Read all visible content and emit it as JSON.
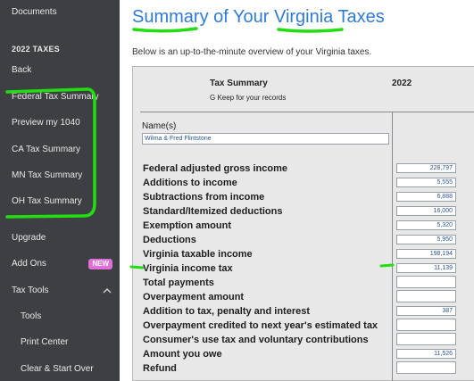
{
  "sidebar": {
    "documents": "Documents",
    "section": "2022 TAXES",
    "back": "Back",
    "items": [
      {
        "label": "Federal Tax Summary"
      },
      {
        "label": "Preview my 1040"
      },
      {
        "label": "CA Tax Summary"
      },
      {
        "label": "MN Tax Summary"
      },
      {
        "label": "OH Tax Summary"
      }
    ],
    "upgrade": "Upgrade",
    "add_ons": "Add Ons",
    "new_badge": "NEW",
    "tax_tools": "Tax Tools",
    "tools": "Tools",
    "print_center": "Print Center",
    "clear_start_over": "Clear & Start Over",
    "colors": {
      "background": "#3d3f43",
      "badge": "#e070d8"
    }
  },
  "main": {
    "title": "Summary of Your Virginia Taxes",
    "subtitle": "Below is an up-to-the-minute overview of your Virginia taxes.",
    "form": {
      "header": "Tax Summary",
      "year": "2022",
      "keep": "G Keep for your records",
      "names_label": "Name(s)",
      "names_value": "Wilma & Fred Flintstone",
      "rows": [
        {
          "label": "Federal adjusted gross income",
          "value": "228,797"
        },
        {
          "label": "Additions to income",
          "value": "5,555"
        },
        {
          "label": "Subtractions from income",
          "value": "6,888"
        },
        {
          "label": "Standard/Itemized deductions",
          "value": "16,000"
        },
        {
          "label": "Exemption amount",
          "value": "5,320"
        },
        {
          "label": "Deductions",
          "value": "5,950"
        },
        {
          "label": "Virginia taxable income",
          "value": "198,194"
        },
        {
          "label": "Virginia income tax",
          "value": "11,139"
        },
        {
          "label": "Total payments",
          "value": ""
        },
        {
          "label": "Overpayment amount",
          "value": ""
        },
        {
          "label": "Addition to tax, penalty and interest",
          "value": "387"
        },
        {
          "label": "Overpayment credited to next year's estimated tax",
          "value": ""
        },
        {
          "label": "Consumer's use tax and voluntary contributions",
          "value": ""
        },
        {
          "label": "Amount you owe",
          "value": "11,526"
        },
        {
          "label": "Refund",
          "value": ""
        }
      ]
    },
    "colors": {
      "title": "#2f7bd6",
      "annotation": "#22dd11"
    }
  }
}
